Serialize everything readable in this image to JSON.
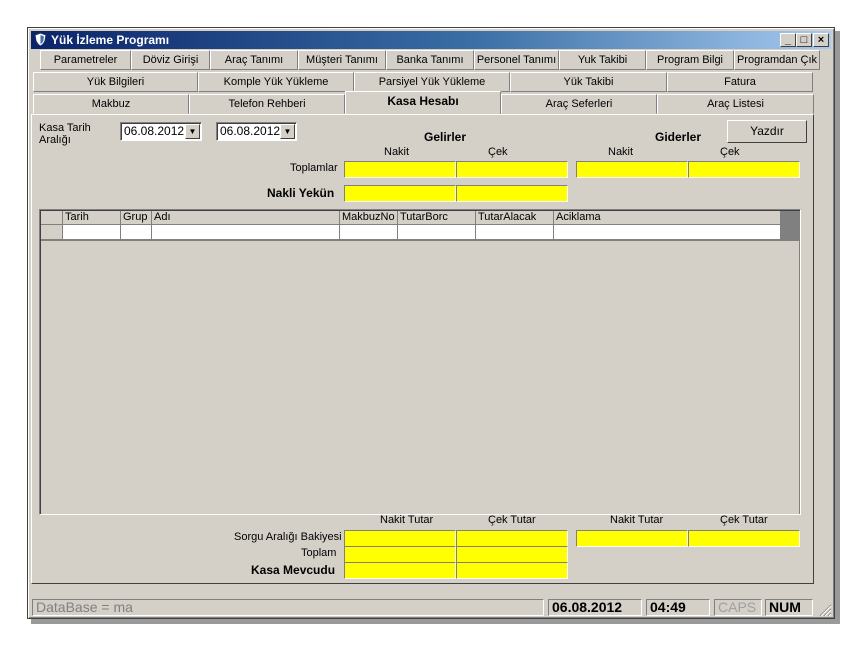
{
  "window": {
    "title": "Yük İzleme Programı",
    "min": "_",
    "max": "□",
    "close": "×"
  },
  "menu_row": [
    "Parametreler",
    "Döviz Girişi",
    "Araç Tanımı",
    "Müşteri Tanımı",
    "Banka Tanımı",
    "Personel Tanımı",
    "Yuk Takibi",
    "Program Bilgi",
    "Programdan Çık"
  ],
  "tabs_row1": [
    "Yük Bilgileri",
    "Komple Yük Yükleme",
    "Parsiyel Yük Yükleme",
    "Yük Takibi",
    "Fatura"
  ],
  "tabs_row2": [
    "Makbuz",
    "Telefon Rehberi",
    "Kasa Hesabı",
    "Araç Seferleri",
    "Araç Listesi"
  ],
  "form": {
    "date_range_label": "Kasa Tarih Aralığı",
    "date_from": "06.08.2012",
    "date_to": "06.08.2012",
    "print_button": "Yazdır",
    "income_header": "Gelirler",
    "expense_header": "Giderler",
    "cash": "Nakit",
    "check": "Çek",
    "totals_label": "Toplamlar",
    "carry_label": "Nakli Yekün"
  },
  "grid": {
    "columns": [
      "Tarih",
      "Grup",
      "Adı",
      "MakbuzNo",
      "TutarBorc",
      "TutarAlacak",
      "Aciklama"
    ]
  },
  "footer": {
    "cash_amount": "Nakit Tutar",
    "check_amount": "Çek Tutar",
    "period_balance_label": "Sorgu Aralığı Bakiyesi",
    "total_label": "Toplam",
    "cash_on_hand_label": "Kasa Mevcudu"
  },
  "status": {
    "database": "DataBase = ma",
    "date": "06.08.2012",
    "time": "04:49",
    "caps": "CAPS",
    "num": "NUM"
  },
  "colors": {
    "field_fill": "#ffff00",
    "title_start": "#0a246a",
    "title_end": "#a6caf0",
    "face": "#d4d0c8"
  }
}
